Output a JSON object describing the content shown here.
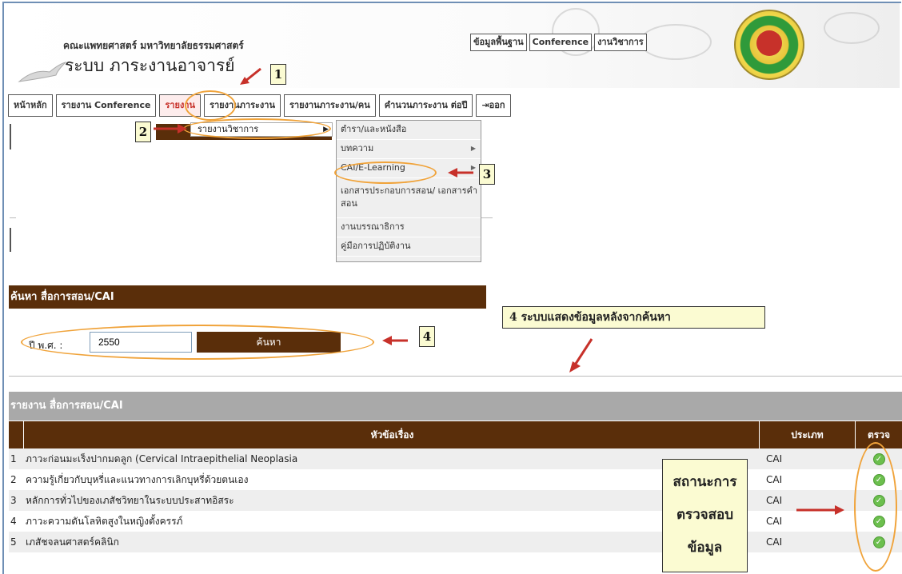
{
  "header": {
    "faculty": "คณะแพทยศาสตร์ มหาวิทยาลัยธรรมศาสตร์",
    "system": "ระบบ ภาระงานอาจารย์",
    "top_links": [
      "ข้อมูลพื้นฐาน",
      "Conference",
      "งานวิชาการ"
    ]
  },
  "menu": {
    "items": [
      "หน้าหลัก",
      "รายงาน Conference",
      "รายงาน",
      "รายงานภาระงาน",
      "รายงานภาระงาน/คน",
      "คำนวนภาระงาน ต่อปี",
      "ออก"
    ]
  },
  "submenu": {
    "item": "รายงานวิชาการ"
  },
  "dropdown": {
    "items": [
      "ตำรา/และหนังสือ",
      "บทความ",
      "CAI/E-Learning",
      "เอกสารประกอบการสอน/ เอกสารคำสอน",
      "งานบรรณาธิการ",
      "คู่มือการปฏิบัติงาน"
    ]
  },
  "search": {
    "title": "ค้นหา สื่อการสอน/CAI",
    "year_label": "ปี พ.ศ. :",
    "year_value": "2550",
    "button": "ค้นหา"
  },
  "report": {
    "title": "รายงาน สื่อการสอน/CAI",
    "columns": [
      "",
      "หัวข้อเรื่อง",
      "ประเภท",
      "ตรวจ"
    ],
    "rows": [
      {
        "no": "1",
        "title": "ภาวะก่อนมะเร็งปากมดลูก (Cervical Intraepithelial Neoplasia",
        "type": "CAI"
      },
      {
        "no": "2",
        "title": "ความรู้เกี่ยวกับบุหรี่และแนวทางการเลิกบุหรี่ด้วยตนเอง",
        "type": "CAI"
      },
      {
        "no": "3",
        "title": "หลักการทั่วไปของเภสัชวิทยาในระบบประสาทอิสระ",
        "type": "CAI"
      },
      {
        "no": "4",
        "title": "ภาวะความดันโลหิตสูงในหญิงตั้งครรภ์",
        "type": "CAI"
      },
      {
        "no": "5",
        "title": "เภสัชจลนศาสตร์คลินิก",
        "type": "CAI"
      }
    ]
  },
  "annotations": {
    "n1": "1",
    "n2": "2",
    "n3": "3",
    "n4": "4",
    "info": "4 ระบบแสดงข้อมูลหลังจากค้นหา",
    "status_1": "สถานะการ",
    "status_2": "ตรวจสอบ",
    "status_3": "ข้อมูล"
  },
  "colors": {
    "brown": "#5a2e0a",
    "accent_red": "#c7312a",
    "oval_orange": "#f0a33a",
    "note_yellow": "#fbfbd2"
  },
  "icons": [
    "bird-logo-icon",
    "university-emblem-icon",
    "exit-icon",
    "submenu-chevron-icon",
    "check-circle-icon",
    "red-arrow-icon"
  ]
}
